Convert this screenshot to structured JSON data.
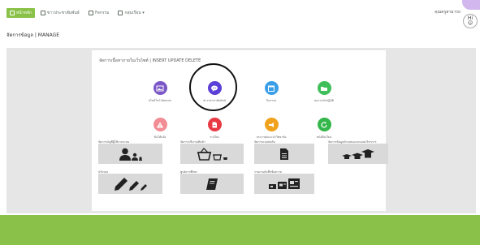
{
  "nav": {
    "items": [
      {
        "label": "หน้าหลัก",
        "active": true
      },
      {
        "label": "ข่าวประชาสัมพันธ์",
        "active": false
      },
      {
        "label": "กิจกรรม",
        "active": false
      },
      {
        "label": "กลุ่มเรียน ▾",
        "active": false
      }
    ]
  },
  "user": {
    "name": "คุณครูสามารถ"
  },
  "page": {
    "title": "จัดการข้อมูล | MANAGE"
  },
  "panel": {
    "title": "จัดการเนื้อหาภายในเว็บไซต์ | INSERT UPDATE DELETE",
    "icons": [
      {
        "label": "สไลด์โชว์ Banner",
        "icon": "image-icon",
        "color": "#7b57c7"
      },
      {
        "label": "ข่าวประชาสัมพันธ์",
        "icon": "chat-icon",
        "color": "#5b3fd6"
      },
      {
        "label": "กิจกรรม",
        "icon": "calendar-icon",
        "color": "#3b9fe8"
      },
      {
        "label": "ผลงานนักปฏิบัติ",
        "icon": "folder-icon",
        "color": "#3fbf5a"
      },
      {
        "label": "ข้อโต้แย้ง",
        "icon": "warning-icon",
        "color": "#f28d96"
      },
      {
        "label": "ระเบียบ",
        "icon": "document-icon",
        "color": "#e83a44"
      },
      {
        "label": "ประกาศ/แนะนำวิทยาลัย",
        "icon": "megaphone-icon",
        "color": "#f1a21c"
      },
      {
        "label": "หนังสือเวียน",
        "icon": "refresh-icon",
        "color": "#33b64a"
      }
    ]
  },
  "cards": [
    {
      "label": "จัดการบัญชีผู้ใช้งานระบบ"
    },
    {
      "label": "จัดการปริมาณสินค้า"
    },
    {
      "label": "จัดการแบบฟอร์ม"
    },
    {
      "label": "จัดการข้อมูลตำแหน่งและแผนกวิชาการ"
    },
    {
      "label": "ปรับปรุง"
    },
    {
      "label": "ศูนย์การศึกษา"
    },
    {
      "label": "รายงานบันทึกข้อความ"
    }
  ],
  "colors": {
    "brand_green": "#8ac249",
    "content_bg": "#e6e6e6",
    "card_bg": "#d9d9d9"
  }
}
